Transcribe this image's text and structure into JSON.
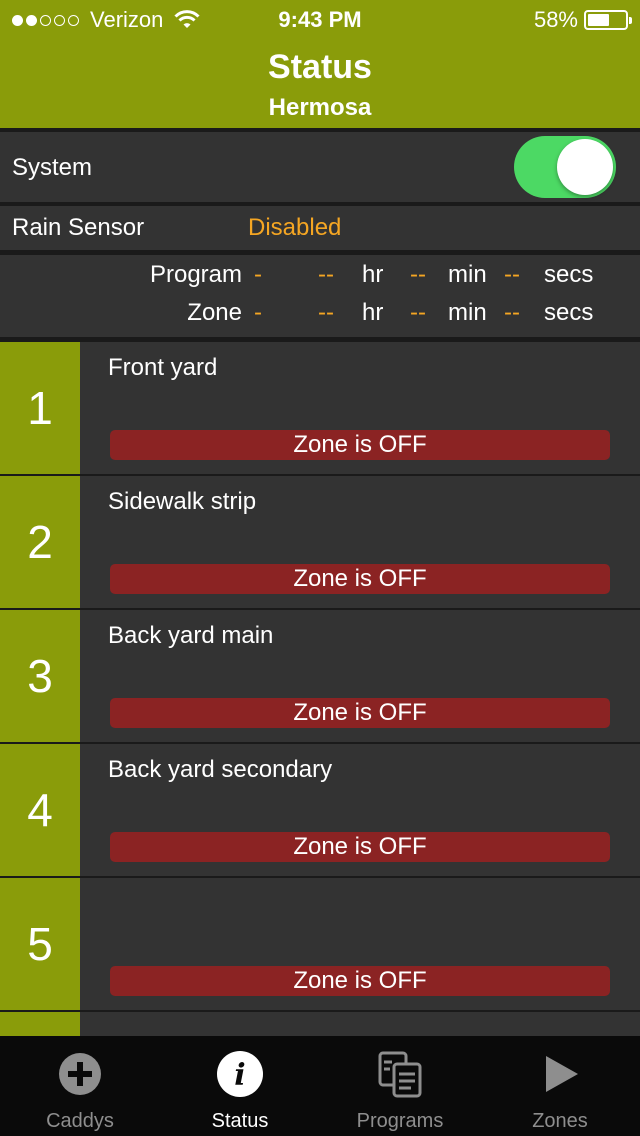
{
  "status_bar": {
    "carrier": "Verizon",
    "time": "9:43 PM",
    "battery": "58%",
    "battery_level": 0.58,
    "signal_bars": 2,
    "signal_total": 5
  },
  "header": {
    "title": "Status",
    "subtitle": "Hermosa"
  },
  "system": {
    "label": "System",
    "enabled": true
  },
  "rain_sensor": {
    "label": "Rain Sensor",
    "value": "Disabled"
  },
  "timer": {
    "program": {
      "label": "Program",
      "value": "-",
      "hr_value": "--",
      "hr_unit": "hr",
      "min_value": "--",
      "min_unit": "min",
      "sec_value": "--",
      "sec_unit": "secs"
    },
    "zone": {
      "label": "Zone",
      "value": "-",
      "hr_value": "--",
      "hr_unit": "hr",
      "min_value": "--",
      "min_unit": "min",
      "sec_value": "--",
      "sec_unit": "secs"
    }
  },
  "zones": [
    {
      "number": "1",
      "name": "Front yard",
      "status": "Zone is OFF"
    },
    {
      "number": "2",
      "name": "Sidewalk strip",
      "status": "Zone is OFF"
    },
    {
      "number": "3",
      "name": "Back yard main",
      "status": "Zone is OFF"
    },
    {
      "number": "4",
      "name": "Back yard secondary",
      "status": "Zone is OFF"
    },
    {
      "number": "5",
      "name": "",
      "status": "Zone is OFF"
    }
  ],
  "tabs": [
    {
      "label": "Caddys",
      "icon": "plus-circle-icon",
      "active": false
    },
    {
      "label": "Status",
      "icon": "info-icon",
      "active": true
    },
    {
      "label": "Programs",
      "icon": "documents-icon",
      "active": false
    },
    {
      "label": "Zones",
      "icon": "play-icon",
      "active": false
    }
  ],
  "colors": {
    "accent": "#8a9c0a",
    "toggle_on": "#4cd964",
    "orange": "#f5a623",
    "zone_off": "#8b2323"
  }
}
